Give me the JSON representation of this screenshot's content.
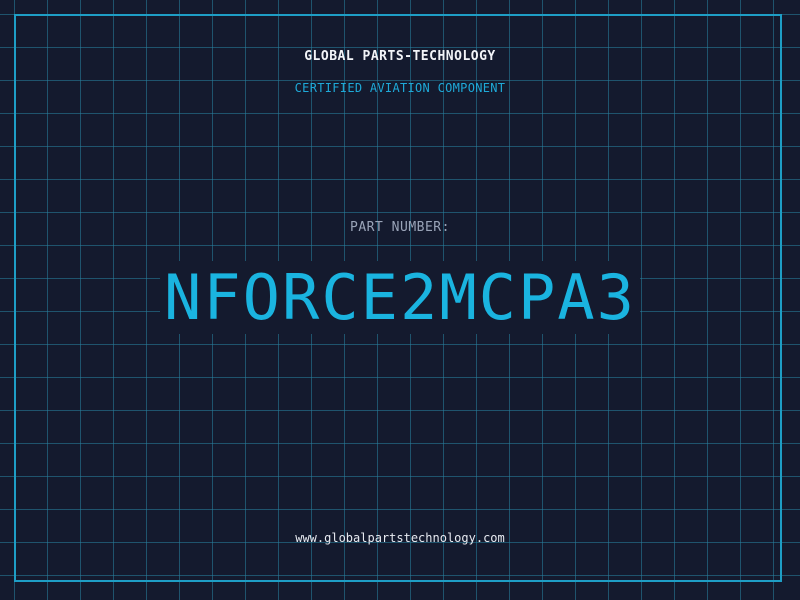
{
  "header": {
    "company": "GLOBAL PARTS-TECHNOLOGY",
    "tagline": "CERTIFIED AVIATION COMPONENT"
  },
  "main": {
    "part_label": "PART NUMBER:",
    "part_number": "NFORCE2MCPA3"
  },
  "footer": {
    "website": "www.globalpartstechnology.com"
  },
  "colors": {
    "background": "#141a2e",
    "grid": "#2882a0",
    "frame": "#1e9ec6",
    "accent": "#1ab4e0",
    "label": "#9aa4b8",
    "text": "#f2f4f8"
  }
}
